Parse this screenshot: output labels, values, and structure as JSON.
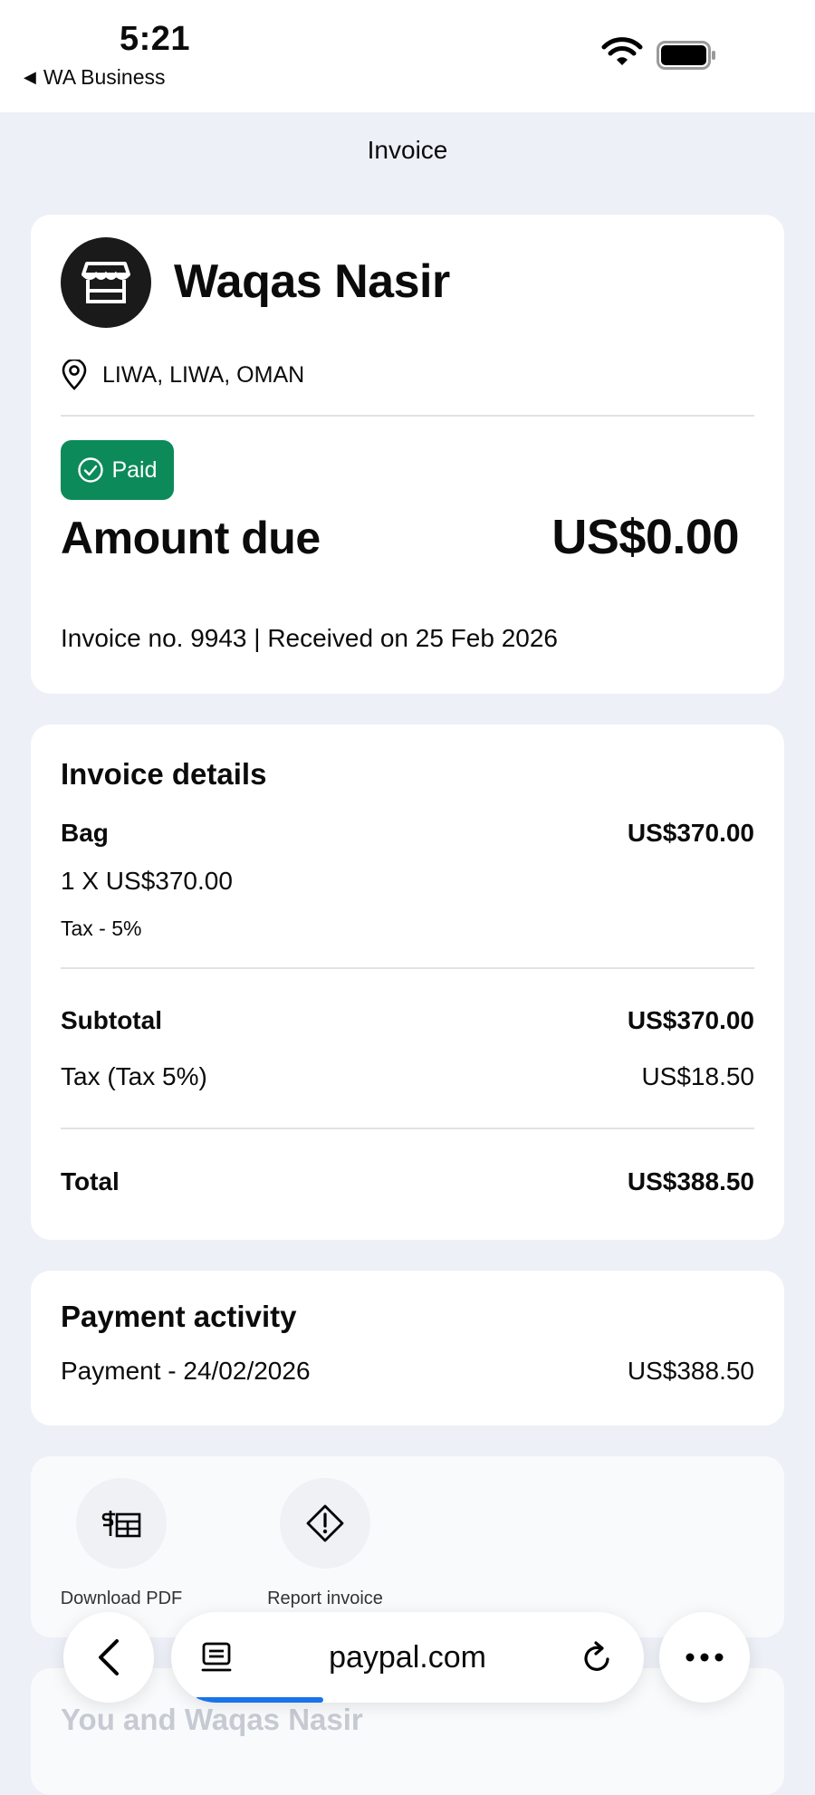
{
  "status_bar": {
    "time": "5:21",
    "back_app": "WA Business"
  },
  "header": {
    "title": "Invoice"
  },
  "merchant": {
    "name": "Waqas Nasir",
    "location": "LIWA, LIWA, OMAN",
    "status": "Paid",
    "amount_label": "Amount due",
    "amount_value": "US$0.00",
    "invoice_meta": "Invoice no. 9943 | Received on 25 Feb 2026"
  },
  "details": {
    "title": "Invoice details",
    "item_name": "Bag",
    "item_price": "US$370.00",
    "item_qty": "1 X US$370.00",
    "item_tax": "Tax - 5%",
    "subtotal_label": "Subtotal",
    "subtotal_value": "US$370.00",
    "tax_label": "Tax (Tax 5%)",
    "tax_value": "US$18.50",
    "total_label": "Total",
    "total_value": "US$388.50"
  },
  "activity": {
    "title": "Payment activity",
    "payment_label": "Payment - 24/02/2026",
    "payment_value": "US$388.50"
  },
  "actions": {
    "download_label": "Download PDF",
    "report_label": "Report invoice"
  },
  "next_section": {
    "title": "You and Waqas Nasir"
  },
  "browser": {
    "url": "paypal.com"
  },
  "icons": {
    "status": [
      "wifi-icon",
      "battery-icon"
    ],
    "merchant": [
      "store-icon",
      "location-pin-icon",
      "check-circle-icon"
    ],
    "actions": [
      "download-pdf-icon",
      "warning-diamond-icon"
    ],
    "browser": [
      "back-arrow-icon",
      "tabs-icon",
      "reload-icon",
      "more-icon"
    ]
  },
  "colors": {
    "paid_badge": "#0c8a5a",
    "background": "#edf0f7",
    "progress": "#1a73e8"
  }
}
